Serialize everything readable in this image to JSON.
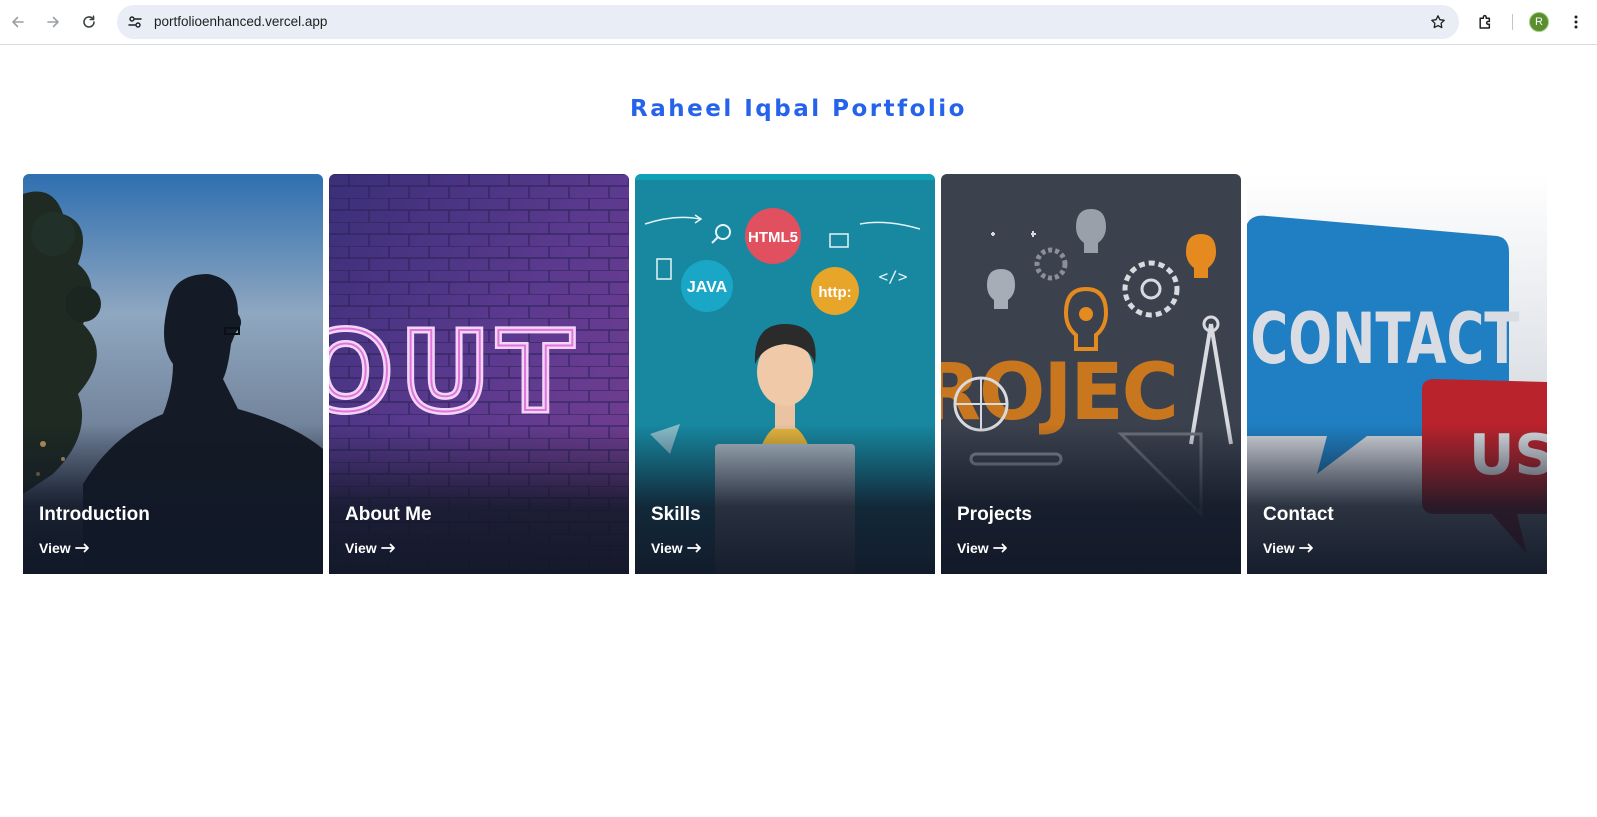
{
  "browser": {
    "url": "portfolioenhanced.vercel.app",
    "profile_initial": "R",
    "icons": [
      "back-icon",
      "forward-icon",
      "reload-icon",
      "site-info-icon",
      "bookmark-star-icon",
      "extensions-icon",
      "kebab-menu-icon"
    ]
  },
  "page": {
    "title": "Raheel Iqbal Portfolio",
    "accent_color": "#2563eb"
  },
  "cards": [
    {
      "title": "Introduction",
      "link": "View"
    },
    {
      "title": "About Me",
      "link": "View"
    },
    {
      "title": "Skills",
      "link": "View"
    },
    {
      "title": "Projects",
      "link": "View"
    },
    {
      "title": "Contact",
      "link": "View"
    }
  ],
  "card_art_text": {
    "about": "OUT",
    "skills_html": "HTML5",
    "skills_java": "JAVA",
    "skills_http": "http:",
    "skills_code": "</>",
    "projects": "ROJEC",
    "contact_main": "CONTACT",
    "contact_us": "US"
  }
}
